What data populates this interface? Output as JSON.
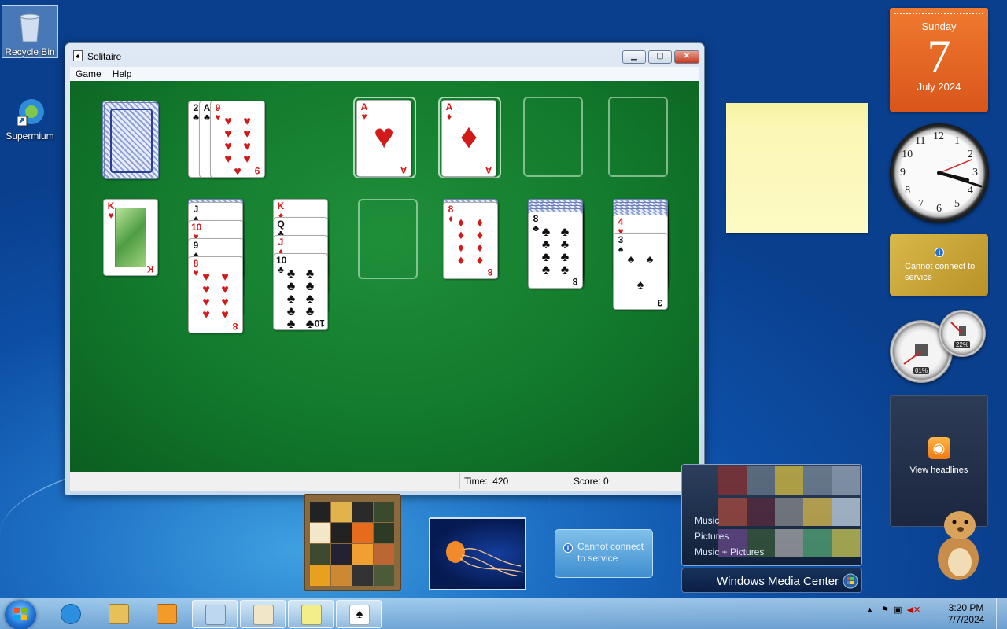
{
  "desktop": {
    "icons": [
      {
        "label": "Recycle Bin",
        "icon": "recycle-bin-icon"
      },
      {
        "label": "Supermium",
        "icon": "supermium-browser-icon"
      }
    ]
  },
  "window": {
    "title": "Solitaire",
    "menu": [
      "Game",
      "Help"
    ],
    "status": {
      "time_label": "Time:",
      "time_value": "420",
      "score_label": "Score:",
      "score_value": "0"
    }
  },
  "game": {
    "waste": [
      {
        "rank": "2",
        "suit": "♣",
        "color": "blk"
      },
      {
        "rank": "A",
        "suit": "♣",
        "color": "blk"
      },
      {
        "rank": "9",
        "suit": "♥",
        "color": "red"
      }
    ],
    "foundations": [
      {
        "rank": "A",
        "suit": "♥",
        "color": "red"
      },
      {
        "rank": "A",
        "suit": "♦",
        "color": "red"
      }
    ],
    "tableau": [
      {
        "down": 0,
        "up": [
          {
            "rank": "K",
            "suit": "♥",
            "color": "red",
            "face": true
          }
        ]
      },
      {
        "down": 1,
        "up": [
          {
            "rank": "J",
            "suit": "♠",
            "color": "blk",
            "face": true
          },
          {
            "rank": "10",
            "suit": "♥",
            "color": "red"
          },
          {
            "rank": "9",
            "suit": "♠",
            "color": "blk"
          },
          {
            "rank": "8",
            "suit": "♥",
            "color": "red"
          }
        ]
      },
      {
        "down": 0,
        "up": [
          {
            "rank": "K",
            "suit": "♦",
            "color": "red",
            "face": true
          },
          {
            "rank": "Q",
            "suit": "♣",
            "color": "blk",
            "face": true
          },
          {
            "rank": "J",
            "suit": "♦",
            "color": "red",
            "face": true
          },
          {
            "rank": "10",
            "suit": "♣",
            "color": "blk"
          }
        ]
      },
      {
        "down": 0,
        "up": []
      },
      {
        "down": 1,
        "up": [
          {
            "rank": "8",
            "suit": "♦",
            "color": "red"
          }
        ]
      },
      {
        "down": 4,
        "up": [
          {
            "rank": "8",
            "suit": "♣",
            "color": "blk"
          }
        ]
      },
      {
        "down": 5,
        "up": [
          {
            "rank": "4",
            "suit": "♥",
            "color": "red"
          },
          {
            "rank": "3",
            "suit": "♠",
            "color": "blk"
          }
        ]
      }
    ]
  },
  "gadgets": {
    "calendar": {
      "weekday": "Sunday",
      "day": "7",
      "month_year": "July 2024"
    },
    "clock": {
      "numbers": [
        "12",
        "1",
        "2",
        "3",
        "4",
        "5",
        "6",
        "7",
        "8",
        "9",
        "10",
        "11"
      ]
    },
    "weather": {
      "message": "Cannot connect to service"
    },
    "cpu_meter": {
      "cpu": "01%",
      "memory": "22%"
    },
    "feeds": {
      "label": "View headlines"
    },
    "weather_small": {
      "message": "Cannot connect to service"
    },
    "media_center": {
      "items": [
        "Music",
        "Pictures",
        "Music + Pictures"
      ],
      "brand": "Windows Media Center"
    }
  },
  "taskbar": {
    "pinned": [
      {
        "name": "internet-explorer-icon",
        "open": false
      },
      {
        "name": "file-explorer-icon",
        "open": false
      },
      {
        "name": "media-player-icon",
        "open": false
      },
      {
        "name": "notepad-icon",
        "open": true
      },
      {
        "name": "paint-icon",
        "open": true
      },
      {
        "name": "sticky-notes-icon",
        "open": true
      },
      {
        "name": "solitaire-icon",
        "open": true
      }
    ],
    "tray": {
      "time": "3:20 PM",
      "date": "7/7/2024"
    }
  }
}
